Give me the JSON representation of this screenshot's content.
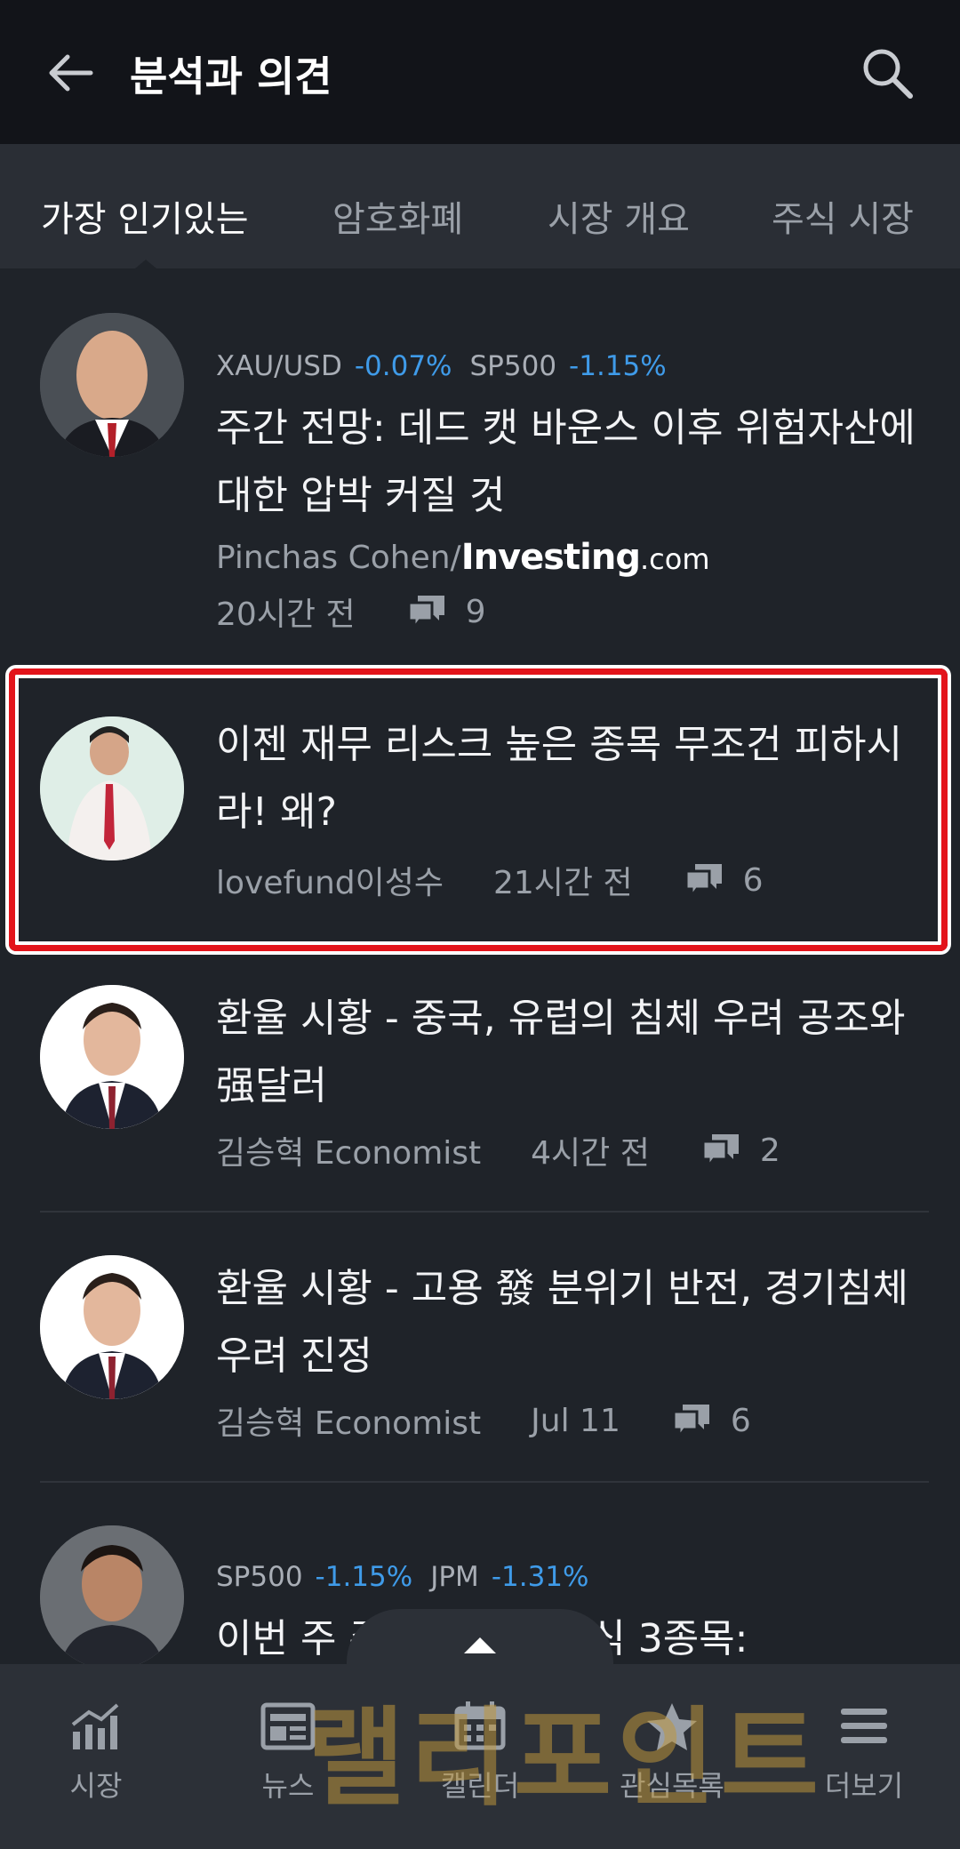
{
  "appbar": {
    "title": "분석과 의견"
  },
  "tabs": [
    {
      "label": "가장 인기있는"
    },
    {
      "label": "암호화폐"
    },
    {
      "label": "시장 개요"
    },
    {
      "label": "주식 시장"
    }
  ],
  "articles": [
    {
      "tickers": [
        {
          "symbol": "XAU/USD",
          "change": "-0.07%"
        },
        {
          "symbol": "SP500",
          "change": "-1.15%"
        }
      ],
      "headline": "주간 전망: 데드 캣 바운스 이후 위험자산에 대한 압박 커질 것",
      "author": "Pinchas Cohen/",
      "source_logo": "Investing",
      "source_logo_suffix": ".com",
      "time": "20시간 전",
      "comments": "9"
    },
    {
      "headline": "이젠 재무 리스크 높은 종목 무조건 피하시라! 왜?",
      "author": "lovefund이성수",
      "time": "21시간 전",
      "comments": "6"
    },
    {
      "headline": "환율 시황 - 중국, 유럽의 침체 우려 공조와 强달러",
      "author": "김승혁 Economist",
      "time": "4시간 전",
      "comments": "2"
    },
    {
      "headline": "환율 시황 - 고용 發 분위기 반전, 경기침체 우려 진정",
      "author": "김승혁 Economist",
      "time": "Jul 11",
      "comments": "6"
    },
    {
      "tickers": [
        {
          "symbol": "SP500",
          "change": "-1.15%"
        },
        {
          "symbol": "JPM",
          "change": "-1.31%"
        }
      ],
      "headline": "이번 주 주목할 만한 주식 3종목:"
    }
  ],
  "bottom_nav": [
    {
      "label": "시장",
      "icon": "market-chart-icon"
    },
    {
      "label": "뉴스",
      "icon": "news-icon"
    },
    {
      "label": "캘린더",
      "icon": "calendar-icon"
    },
    {
      "label": "관심목록",
      "icon": "star-icon"
    },
    {
      "label": "더보기",
      "icon": "menu-icon"
    }
  ],
  "watermark": "랠리포인트",
  "colors": {
    "background": "#1f2329",
    "appbar": "#121419",
    "change_negative": "#3f9be9",
    "highlight_border": "#e3141b"
  }
}
